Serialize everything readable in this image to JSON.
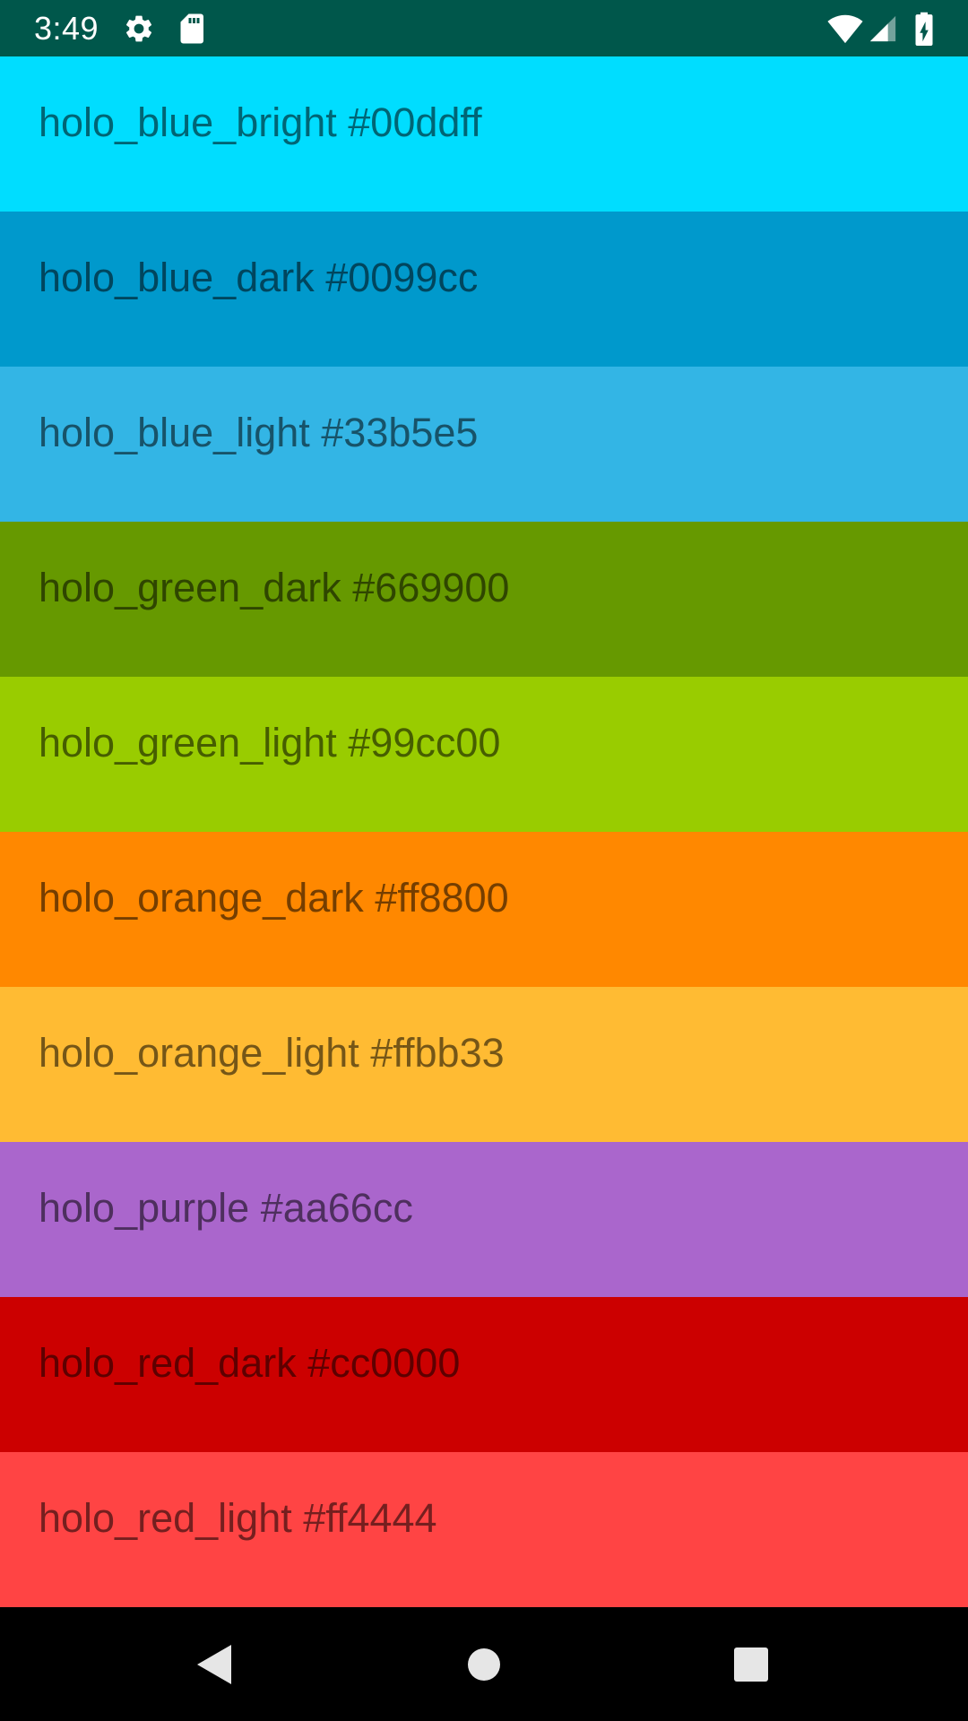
{
  "status_bar": {
    "time": "3:49",
    "background": "#00574b",
    "icons": [
      "gear-icon",
      "sd-card-icon",
      "wifi-icon",
      "cell-signal-icon",
      "battery-charging-icon"
    ]
  },
  "colors": [
    {
      "label": "holo_blue_bright #00ddff",
      "hex": "#00ddff"
    },
    {
      "label": "holo_blue_dark #0099cc",
      "hex": "#0099cc"
    },
    {
      "label": "holo_blue_light #33b5e5",
      "hex": "#33b5e5"
    },
    {
      "label": "holo_green_dark #669900",
      "hex": "#669900"
    },
    {
      "label": "holo_green_light #99cc00",
      "hex": "#99cc00"
    },
    {
      "label": "holo_orange_dark #ff8800",
      "hex": "#ff8800"
    },
    {
      "label": "holo_orange_light #ffbb33",
      "hex": "#ffbb33"
    },
    {
      "label": "holo_purple #aa66cc",
      "hex": "#aa66cc"
    },
    {
      "label": "holo_red_dark #cc0000",
      "hex": "#cc0000"
    },
    {
      "label": "holo_red_light #ff4444",
      "hex": "#ff4444"
    }
  ],
  "nav_bar": {
    "buttons": [
      "back-icon",
      "home-icon",
      "recents-icon"
    ]
  }
}
